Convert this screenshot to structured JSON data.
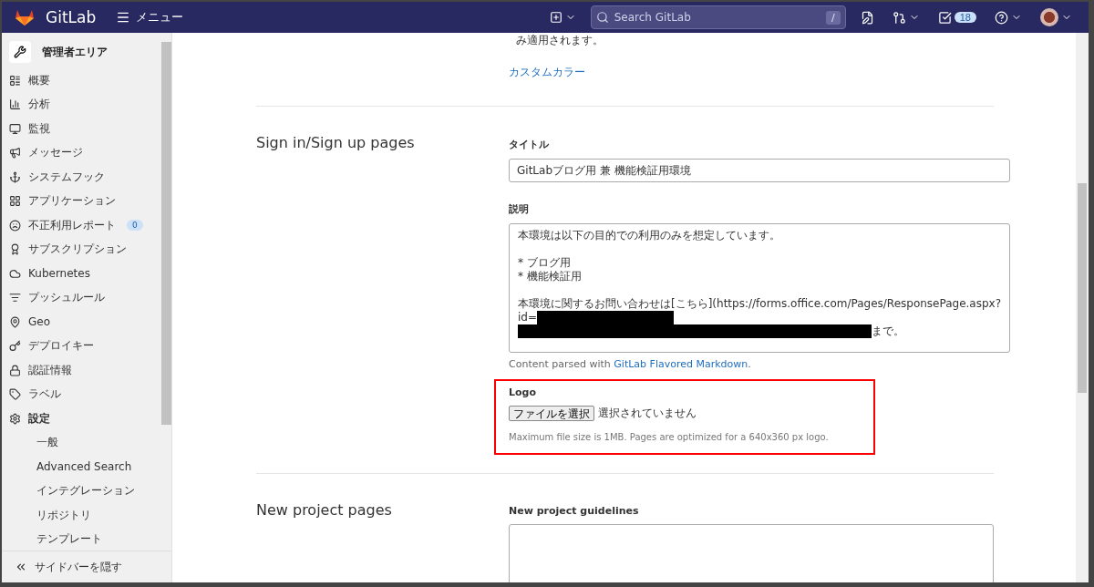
{
  "header": {
    "brand": "GitLab",
    "menu": "メニュー",
    "search": {
      "placeholder": "Search GitLab",
      "shortcut": "/"
    },
    "todo_count": "18"
  },
  "sidebar": {
    "title": "管理者エリア",
    "items": [
      {
        "kind": "main",
        "label": "概要",
        "selected": false
      },
      {
        "kind": "main",
        "label": "分析",
        "selected": false
      },
      {
        "kind": "main",
        "label": "監視",
        "selected": false
      },
      {
        "kind": "main",
        "label": "メッセージ",
        "selected": false
      },
      {
        "kind": "main",
        "label": "システムフック",
        "selected": false
      },
      {
        "kind": "main",
        "label": "アプリケーション",
        "selected": false
      },
      {
        "kind": "main",
        "label": "不正利用レポート",
        "badge": "0",
        "selected": false
      },
      {
        "kind": "main",
        "label": "サブスクリプション",
        "selected": false
      },
      {
        "kind": "main",
        "label": "Kubernetes",
        "selected": false
      },
      {
        "kind": "main",
        "label": "プッシュルール",
        "selected": false
      },
      {
        "kind": "main",
        "label": "Geo",
        "selected": false
      },
      {
        "kind": "main",
        "label": "デプロイキー",
        "selected": false
      },
      {
        "kind": "main",
        "label": "認証情報",
        "selected": false
      },
      {
        "kind": "main",
        "label": "ラベル",
        "selected": false
      },
      {
        "kind": "main",
        "label": "設定",
        "selected": true
      },
      {
        "kind": "sub",
        "label": "一般",
        "selected": false
      },
      {
        "kind": "sub",
        "label": "Advanced Search",
        "selected": false
      },
      {
        "kind": "sub",
        "label": "インテグレーション",
        "selected": false
      },
      {
        "kind": "sub",
        "label": "リポジトリ",
        "selected": false
      },
      {
        "kind": "sub",
        "label": "テンプレート",
        "selected": false
      }
    ],
    "collapse": "サイドバーを隠す"
  },
  "content": {
    "top_note": "み適用されます。",
    "custom_color_link": "カスタムカラー",
    "sections": [
      {
        "title": "Sign in/Sign up pages",
        "title_field": {
          "label": "タイトル",
          "value": "GitLabブログ用 兼 機能検証用環境"
        },
        "description_field": {
          "label": "説明",
          "lines": [
            {
              "kind": "text",
              "segments": [
                {
                  "kind": "text",
                  "text": "本環境は以下の目的での利用のみを想定しています。"
                }
              ]
            },
            {
              "kind": "blank"
            },
            {
              "kind": "text",
              "segments": [
                {
                  "kind": "text",
                  "text": "* ブログ用"
                }
              ]
            },
            {
              "kind": "text",
              "segments": [
                {
                  "kind": "text",
                  "text": "* 機能検証用"
                }
              ]
            },
            {
              "kind": "blank"
            },
            {
              "kind": "text",
              "segments": [
                {
                  "kind": "text",
                  "text": "本環境に関するお問い合わせは[こちら](https://forms.office.com/Pages/ResponsePage.aspx?"
                }
              ]
            },
            {
              "kind": "text",
              "segments": [
                {
                  "kind": "text",
                  "text": "id="
                },
                {
                  "kind": "redaction_short"
                }
              ]
            },
            {
              "kind": "text",
              "segments": [
                {
                  "kind": "redaction_long"
                },
                {
                  "kind": "text",
                  "text": "まで。"
                }
              ]
            }
          ]
        },
        "help_prefix": "Content parsed with",
        "help_link": "GitLab Flavored Markdown",
        "help_suffix": ".",
        "logo": {
          "label": "Logo",
          "button": "ファイルを選択",
          "status": "選択されていません",
          "hint": "Maximum file size is 1MB. Pages are optimized for a 640x360 px logo.",
          "highlighted": true
        }
      },
      {
        "title": "New project pages",
        "guidelines_label": "New project guidelines"
      }
    ]
  }
}
